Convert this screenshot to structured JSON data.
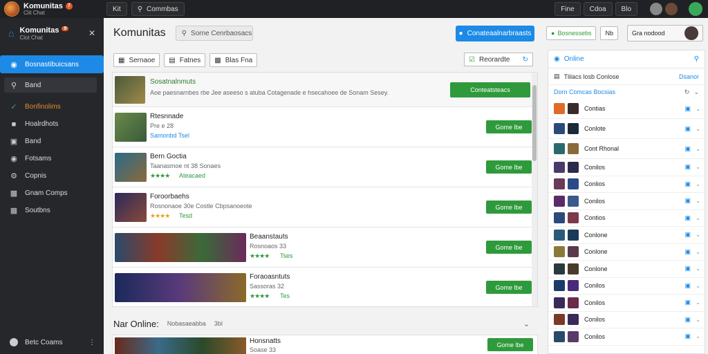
{
  "app": {
    "name": "Komunitas",
    "badge": "7",
    "sub": "Clit Chat"
  },
  "topbar": {
    "tab1": "Kit",
    "search_label": "Commbas",
    "btn1": "Fine",
    "btn2": "Cdoa",
    "btn3": "Blo"
  },
  "sidebar": {
    "title": "Komunitas",
    "badge": "9",
    "subtitle": "Clot Chat",
    "active": "Bosnastibuicsans",
    "search": "Band",
    "items": [
      {
        "icon": "checkmark-icon",
        "label": "Bonfinolims",
        "color": "#e58a2a"
      },
      {
        "icon": "gamepad-icon",
        "label": "Hoalrdhots",
        "color": "#dddddd"
      },
      {
        "icon": "store-icon",
        "label": "Band",
        "color": "#dddddd"
      },
      {
        "icon": "globe-icon",
        "label": "Fotsams",
        "color": "#dddddd"
      },
      {
        "icon": "gear-icon",
        "label": "Copnis",
        "color": "#dddddd"
      },
      {
        "icon": "controller-icon",
        "label": "Gnam Comps",
        "color": "#dddddd"
      },
      {
        "icon": "calendar-icon",
        "label": "Soutbns",
        "color": "#dddddd"
      }
    ],
    "bottom": "Betc Coams"
  },
  "main": {
    "title": "Komunitas",
    "search": "Sorne Cenrbaosacs",
    "blue_btn": "Conateaalnarbraasts",
    "filters": [
      "Sernaoe",
      "Fatnes",
      "Blas Fna"
    ],
    "group_select": "Reorardte",
    "rows": [
      {
        "name": "Sosatnalnmuts",
        "meta": "Aoe paesnarnbes rbe Jee aseeso s atuba Cotagenade e hsecahoee de Sonam Sesey.",
        "stat": "",
        "btn": "Conteatsteacs"
      },
      {
        "name": "Rtesnnade",
        "meta": "Pre e 28",
        "stat": "Samonbd Tsel",
        "btn": "Gome lbe"
      },
      {
        "name": "Bern Goctia",
        "meta": "Taanasmoe nt 38 Sonaes",
        "stat": "Ateacaed",
        "btn": "Gome lbe"
      },
      {
        "name": "Foroorbaehs",
        "meta": "Rosnonaoe 30e Costle  Cbpsanoeote",
        "stat": "Tesd",
        "btn": "Gome lbe"
      },
      {
        "name": "Beaanstauts",
        "meta": "Rosnoaos 33",
        "stat": "Tses",
        "btn": "Gome lbe"
      },
      {
        "name": "Foraoasntuts",
        "meta": "Sassoras 32",
        "stat": "Tes",
        "btn": "Gome lbe"
      }
    ],
    "not_online": "Nar Online:",
    "not_online_sub": "Nobasaeabba",
    "not_online_count": "3bl",
    "last_row": {
      "name": "Honsnatts",
      "meta": "Soase 33",
      "btn": "Gome lbe"
    }
  },
  "right": {
    "online_btn": "Bosnessebs",
    "small_btn": "Nb",
    "radar": "Gra nodood",
    "panel_online": "Online",
    "header": "Tlilacs losb Conlose",
    "header_right": "Dsanor",
    "section": "Dorn Comcas Bocsias",
    "friends": [
      "Contias",
      "Conlote",
      "Cont Rhonal",
      "Conilos",
      "Conlios",
      "Conilos",
      "Contios",
      "Conlone",
      "Conlone",
      "Conlone",
      "Conilos",
      "Conilos",
      "Conilos",
      "Conilos"
    ]
  }
}
